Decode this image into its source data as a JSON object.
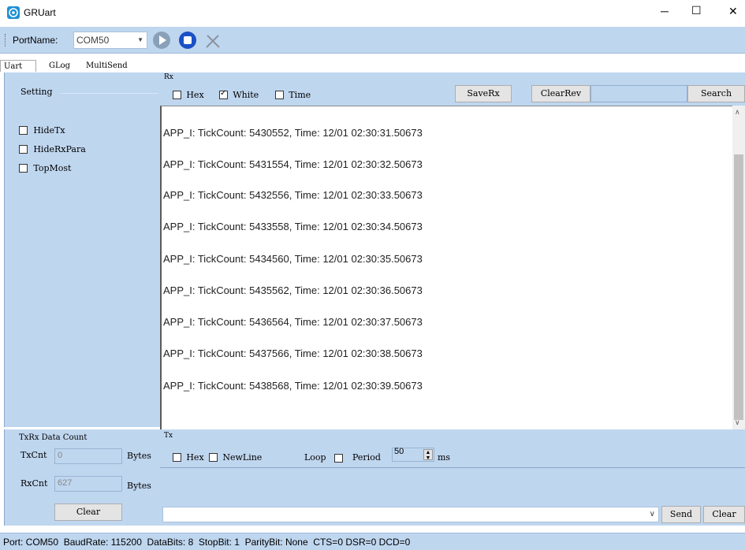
{
  "window": {
    "title": "GRUart",
    "minimize_glyph": "─",
    "maximize_glyph": "☐",
    "close_glyph": "✕"
  },
  "toolbar": {
    "port_label": "PortName:",
    "port_value": "COM50"
  },
  "tabs": [
    "Uart",
    "GLog",
    "MultiSend"
  ],
  "setting": {
    "title": "Setting",
    "options": [
      {
        "label": "HideTx",
        "checked": false
      },
      {
        "label": "HideRxPara",
        "checked": false
      },
      {
        "label": "TopMost",
        "checked": false
      }
    ]
  },
  "rx": {
    "title": "Rx",
    "hex_label": "Hex",
    "white_label": "White",
    "time_label": "Time",
    "save_label": "SaveRx",
    "clear_label": "ClearRev",
    "search_value": "",
    "search_label": "Search",
    "lines": [
      "APP_I: TickCount: 5430552, Time: 12/01 02:30:31.50673",
      "APP_I: TickCount: 5431554, Time: 12/01 02:30:32.50673",
      "APP_I: TickCount: 5432556, Time: 12/01 02:30:33.50673",
      "APP_I: TickCount: 5433558, Time: 12/01 02:30:34.50673",
      "APP_I: TickCount: 5434560, Time: 12/01 02:30:35.50673",
      "APP_I: TickCount: 5435562, Time: 12/01 02:30:36.50673",
      "APP_I: TickCount: 5436564, Time: 12/01 02:30:37.50673",
      "APP_I: TickCount: 5437566, Time: 12/01 02:30:38.50673",
      "APP_I: TickCount: 5438568, Time: 12/01 02:30:39.50673"
    ]
  },
  "count": {
    "title": "TxRx Data Count",
    "tx_label": "TxCnt",
    "tx_value": "0",
    "rx_label": "RxCnt",
    "rx_value": "627",
    "unit": "Bytes",
    "clear_label": "Clear"
  },
  "tx": {
    "title": "Tx",
    "hex_label": "Hex",
    "newline_label": "NewLine",
    "loop_label": "Loop",
    "period_label": "Period",
    "period_value": "50",
    "period_unit": "ms",
    "send_label": "Send",
    "clear_label": "Clear"
  },
  "status": "Port: COM50  BaudRate: 115200  DataBits: 8  StopBit: 1  ParityBit: None  CTS=0 DSR=0 DCD=0"
}
